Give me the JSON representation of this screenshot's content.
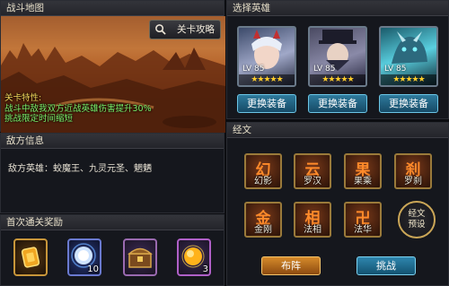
{
  "map": {
    "title": "战斗地图",
    "strategy_button": "关卡攻略",
    "traits_title": "关卡特性:",
    "traits_lines": [
      "战斗中敌我双方近战英雄伤害提升30%",
      "挑战限定时间缩短"
    ]
  },
  "enemy": {
    "title": "敌方信息",
    "label": "敌方英雄：",
    "heroes": "蛟魔王、九灵元圣、魍魉"
  },
  "rewards": {
    "title": "首次通关奖励",
    "items": [
      {
        "icon": "gold-ingot-icon",
        "count": ""
      },
      {
        "icon": "blue-orb-icon",
        "count": "10"
      },
      {
        "icon": "treasure-chest-icon",
        "count": ""
      },
      {
        "icon": "gold-orb-icon",
        "count": "3"
      }
    ]
  },
  "heroes": {
    "title": "选择英雄",
    "cards": [
      {
        "level": "LV 85",
        "stars": "★★★★★",
        "equip_label": "更换装备"
      },
      {
        "level": "LV 85",
        "stars": "★★★★★",
        "equip_label": "更换装备"
      },
      {
        "level": "LV 85",
        "stars": "★★★★★",
        "equip_label": "更换装备"
      }
    ]
  },
  "sutra": {
    "title": "经文",
    "items": [
      {
        "name": "幻影",
        "glyph": "幻"
      },
      {
        "name": "罗汉",
        "glyph": "云"
      },
      {
        "name": "果乘",
        "glyph": "果"
      },
      {
        "name": "罗刹",
        "glyph": "刹"
      },
      {
        "name": "金刚",
        "glyph": "金"
      },
      {
        "name": "法相",
        "glyph": "相"
      },
      {
        "name": "法华",
        "glyph": "卍"
      }
    ],
    "preset_line1": "经文",
    "preset_line2": "预设"
  },
  "actions": {
    "formation": "布阵",
    "fight": "挑战"
  }
}
